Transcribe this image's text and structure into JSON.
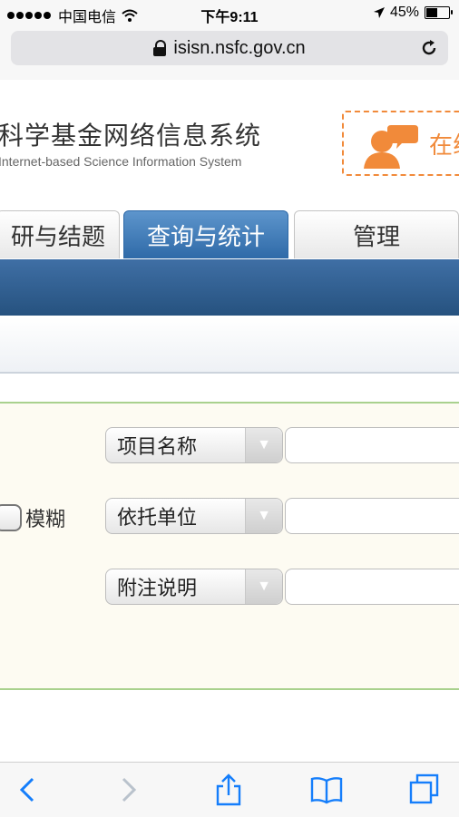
{
  "status_bar": {
    "carrier": "中国电信",
    "time": "下午9:11",
    "battery": "45%",
    "battery_level": 0.45
  },
  "address_bar": {
    "url": "isisn.nsfc.gov.cn"
  },
  "header": {
    "title_cn": "科学基金网络信息系统",
    "title_en": "Internet-based Science Information System",
    "online_label": "在线"
  },
  "tabs": [
    {
      "label": "研与结题"
    },
    {
      "label": "查询与统计"
    },
    {
      "label": "管理"
    }
  ],
  "search": {
    "fuzzy_label": "模糊",
    "fields": [
      {
        "select": "项目名称",
        "value": ""
      },
      {
        "select": "依托单位",
        "value": ""
      },
      {
        "select": "附注说明",
        "value": ""
      }
    ]
  },
  "colors": {
    "accent": "#2f6aa8",
    "orange": "#f18a3a",
    "panel_border": "#a9d18e",
    "ios_blue": "#157efb"
  },
  "icons": [
    "lock-icon",
    "reload-icon",
    "chat-icon",
    "back-icon",
    "forward-icon",
    "share-icon",
    "bookmarks-icon",
    "tabs-icon"
  ]
}
